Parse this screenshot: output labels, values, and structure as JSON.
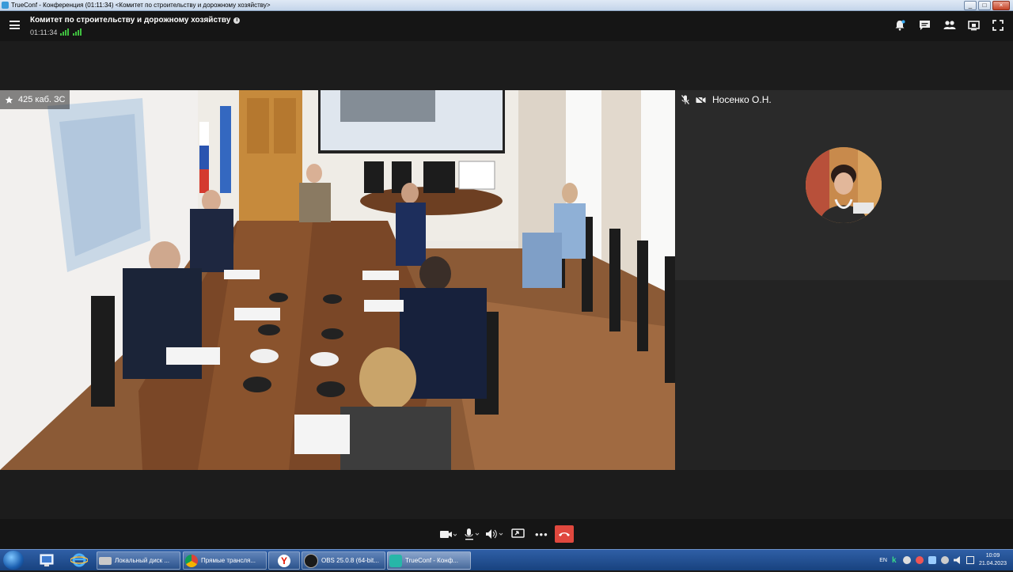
{
  "window": {
    "title": "TrueConf - Конференция (01:11:34) <Комитет по строительству и дорожному хозяйству>"
  },
  "header": {
    "conference_title": "Комитет по строительству и дорожному хозяйству",
    "info_icon": "i",
    "elapsed": "01:11:34",
    "icons": [
      "bell-icon",
      "chat-icon",
      "participants-icon",
      "share-icon",
      "fullscreen-icon"
    ]
  },
  "main_video": {
    "label": "425 каб. ЗС",
    "icon": "star-icon"
  },
  "side_video": {
    "label": "Носенко О.Н.",
    "icons": [
      "mic-muted-icon",
      "camera-muted-icon"
    ]
  },
  "toolbar": {
    "buttons": [
      "camera-icon",
      "microphone-icon",
      "speaker-icon",
      "screen-share-icon",
      "more-icon",
      "hangup-icon"
    ],
    "more_label": "•••"
  },
  "taskbar": {
    "items": [
      {
        "label": "Локальный диск ...",
        "icon": "drive-icon"
      },
      {
        "label": "Прямые трансля...",
        "icon": "chrome-icon"
      },
      {
        "label": "",
        "icon": "yandex-icon"
      },
      {
        "label": "OBS 25.0.8 (64-bit...",
        "icon": "obs-icon"
      },
      {
        "label": "TrueConf - Конф...",
        "icon": "trueconf-icon"
      }
    ],
    "language": "EN",
    "time": "10:09",
    "date": "21.04.2023"
  },
  "colors": {
    "accent_green": "#3fbf3f",
    "hangup_red": "#e0483e",
    "taskbar_blue": "#1f4f92"
  }
}
